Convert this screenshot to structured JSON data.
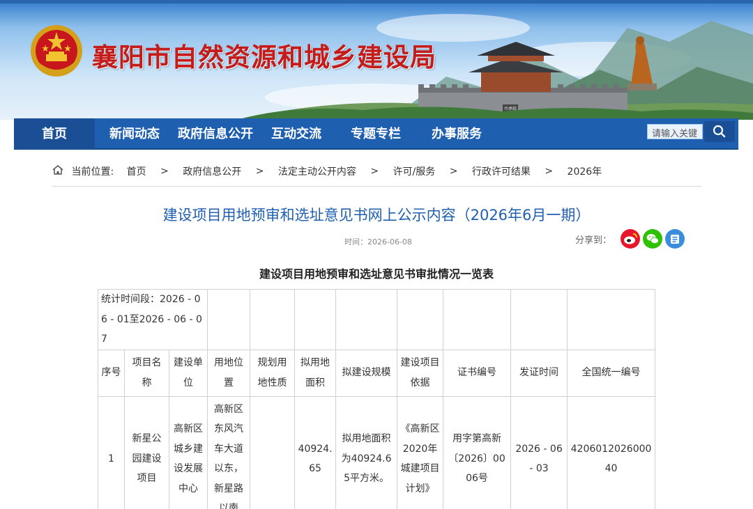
{
  "header": {
    "site_title": "襄阳市自然资源和城乡建设局",
    "gate_plaque": "巾承临"
  },
  "nav": {
    "items": [
      {
        "label": "首页",
        "active": true
      },
      {
        "label": "新闻动态"
      },
      {
        "label": "政府信息公开"
      },
      {
        "label": "互动交流"
      },
      {
        "label": "专题专栏"
      },
      {
        "label": "办事服务"
      }
    ],
    "search_placeholder": "请输入关键"
  },
  "breadcrumb": {
    "prefix": "当前位置:",
    "items": [
      "首页",
      "政府信息公开",
      "法定主动公开内容",
      "许可/服务",
      "行政许可结果",
      "2026年"
    ],
    "separator": ">"
  },
  "article": {
    "title": "建设项目用地预审和选址意见书网上公示内容（2026年6月一期）",
    "time": "时间：2026-06-08",
    "share_label": "分享到：",
    "share_icons": [
      "weibo-icon",
      "wechat-icon",
      "qq-zone-icon"
    ],
    "table_title": "建设项目用地预审和选址意见书审批情况一览表"
  },
  "table": {
    "period": "统计时间段：2026 - 06 - 01至2026 - 06 - 07",
    "headers": [
      "序号",
      "项目名称",
      "建设单位",
      "用地位置",
      "规划用地性质",
      "拟用地面积",
      "拟建设规模",
      "建设项目依据",
      "证书编号",
      "发证时间",
      "全国统一编号"
    ],
    "rows": [
      [
        "1",
        "新星公园建设项目",
        "高新区城乡建设发展中心",
        "高新区东风汽车大道以东，新星路以南",
        "",
        "40924.65",
        "拟用地面积为40924.65平方米。",
        "《高新区2020年城建项目计划》",
        "用字第高新〔2026〕0006号",
        "2026 - 06 - 03",
        "420601202600040"
      ]
    ]
  },
  "colors": {
    "nav_bg": "#1f5fb0",
    "title_red": "#c41b1b",
    "link_blue": "#1f5fb0",
    "weibo": "#e6162d",
    "wechat": "#2dc100",
    "qzone": "#3b8cdb"
  }
}
